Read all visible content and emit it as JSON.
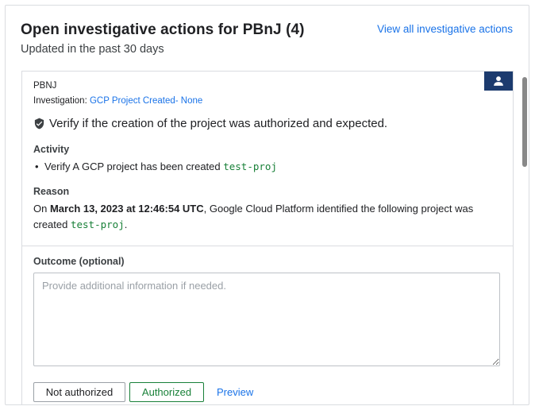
{
  "header": {
    "title": "Open investigative actions for PBnJ (4)",
    "subtitle": "Updated in the past 30 days",
    "view_all": "View all investigative actions"
  },
  "action": {
    "company": "PBNJ",
    "investigation_label": "Investigation:",
    "investigation_link": "GCP Project Created- None",
    "shield_icon": "shield-check-icon",
    "assignee_icon": "person-icon",
    "text": "Verify if the creation of the project was authorized and expected.",
    "activity_label": "Activity",
    "activity_items": [
      {
        "text": "Verify A GCP project has been created ",
        "code": "test-proj"
      }
    ],
    "reason_label": "Reason",
    "reason": {
      "prefix": "On ",
      "date": "March 13, 2023 at 12:46:54 UTC",
      "middle": ", Google Cloud Platform identified the following project was created ",
      "code": "test-proj",
      "suffix": "."
    }
  },
  "outcome": {
    "label": "Outcome (optional)",
    "placeholder": "Provide additional information if needed.",
    "value": ""
  },
  "buttons": {
    "not_authorized": "Not authorized",
    "authorized": "Authorized",
    "preview": "Preview"
  },
  "colors": {
    "link": "#1a73e8",
    "code": "#188038",
    "assignee_bg": "#1c3b6e",
    "authorized": "#188038"
  }
}
